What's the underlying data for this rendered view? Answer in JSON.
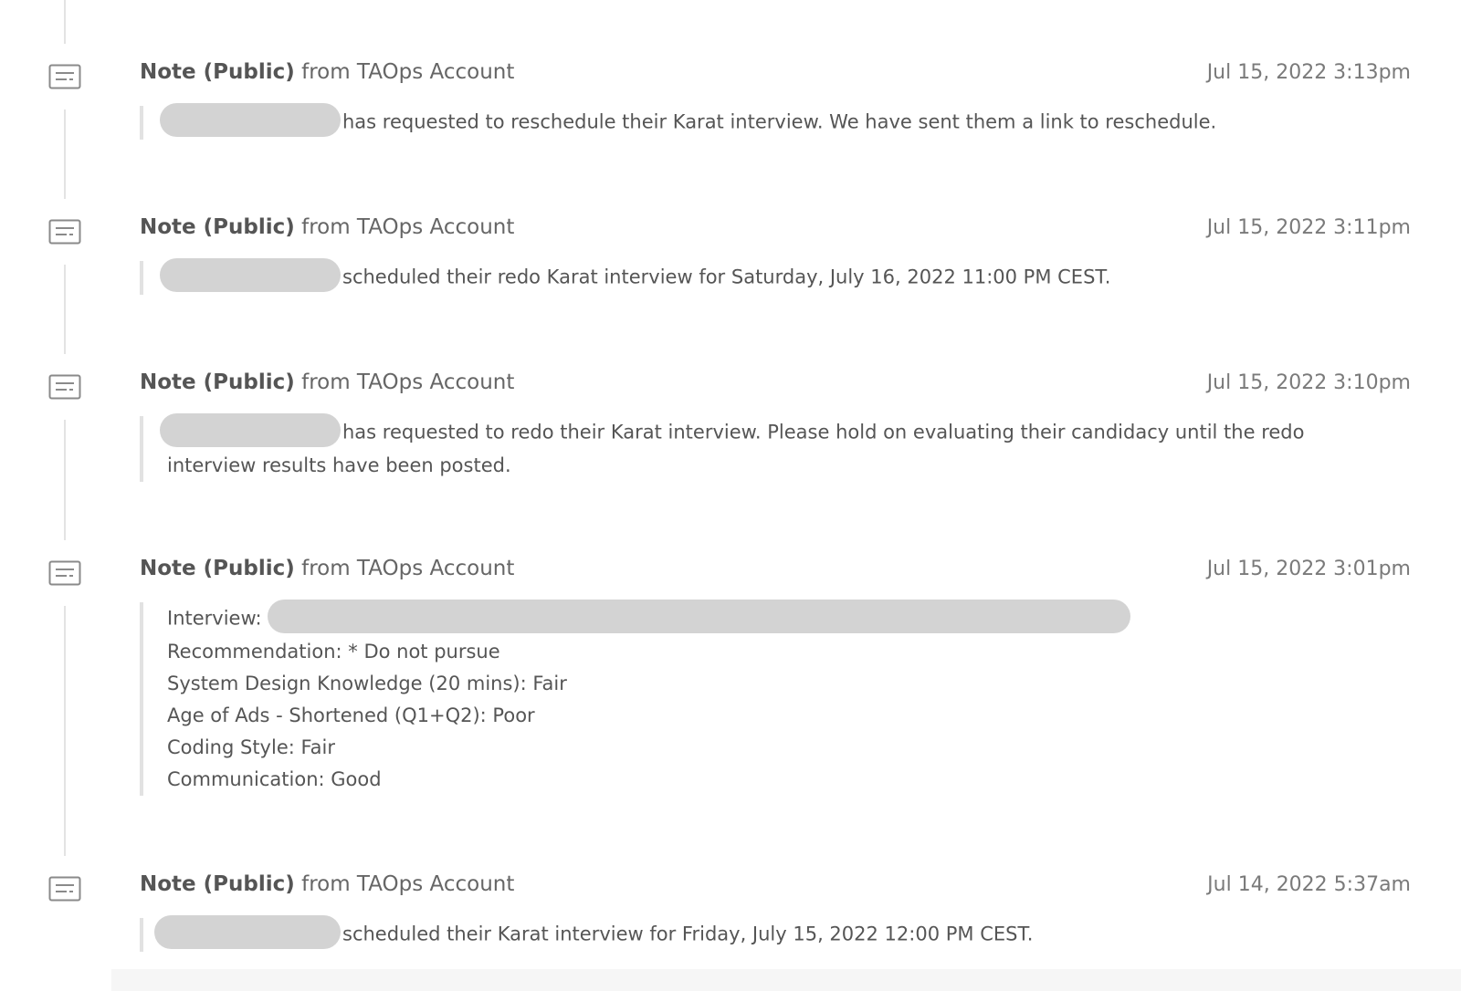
{
  "notes": [
    {
      "title": "Note (Public)",
      "from": "from TAOps Account",
      "time": "Jul 15, 2022 3:13pm",
      "text": "has requested to reschedule their Karat interview. We have sent them a link to reschedule."
    },
    {
      "title": "Note (Public)",
      "from": "from TAOps Account",
      "time": "Jul 15, 2022 3:11pm",
      "text": "scheduled their redo Karat interview for Saturday, July 16, 2022 11:00 PM CEST."
    },
    {
      "title": "Note (Public)",
      "from": "from TAOps Account",
      "time": "Jul 15, 2022 3:10pm",
      "text": "has requested to redo their Karat interview. Please hold on evaluating their candidacy until the redo interview results have been posted."
    },
    {
      "title": "Note (Public)",
      "from": "from TAOps Account",
      "time": "Jul 15, 2022 3:01pm",
      "interview_label": "Interview:",
      "lines": [
        "Recommendation: * Do not pursue",
        "System Design Knowledge (20 mins): Fair",
        "Age of Ads - Shortened (Q1+Q2): Poor",
        "Coding Style: Fair",
        "Communication: Good"
      ]
    },
    {
      "title": "Note (Public)",
      "from": "from TAOps Account",
      "time": "Jul 14, 2022 5:37am",
      "text": "scheduled their Karat interview for Friday, July 15, 2022 12:00 PM CEST."
    }
  ],
  "icon": "note-icon",
  "colors": {
    "redaction": "#d3d3d3",
    "timeline": "#e3e3e3",
    "text": "#555555"
  }
}
